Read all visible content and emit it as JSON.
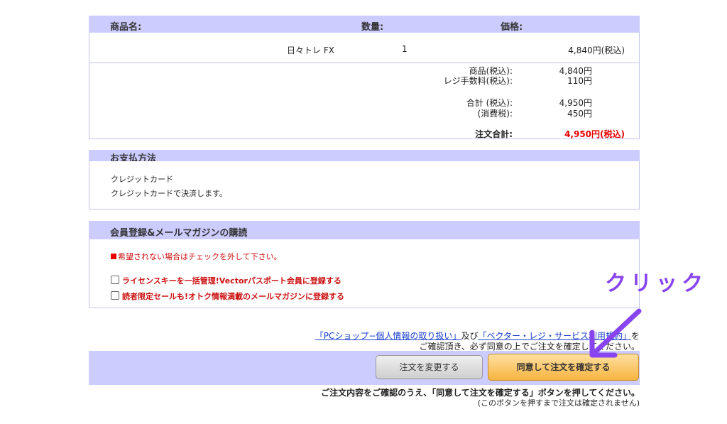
{
  "order_table": {
    "headers": {
      "product": "商品名:",
      "quantity": "数量:",
      "price": "価格:"
    },
    "row": {
      "product": "日々トレ  FX",
      "quantity": "1",
      "price": "4,840円(税込)"
    },
    "summary": {
      "product_label": "商品(税込):",
      "product_value": "4,840円",
      "fee_label": "レジ手数料(税込):",
      "fee_value": "110円",
      "total_label": "合計 (税込):",
      "total_value": "4,950円",
      "tax_label": "(消費税):",
      "tax_value": "450円",
      "order_total_label": "注文合計:",
      "order_total_value": "4,950円(税込)"
    }
  },
  "payment": {
    "title": "お支払方法",
    "method": "クレジットカード",
    "description": "クレジットカードで決済します。"
  },
  "membership": {
    "title": "会員登録&メールマガジンの購読",
    "notice": "希望されない場合はチェックを外して下さい。",
    "option1": "ライセンスキーを一括管理!Vectorパスポート会員に登録する",
    "option2": "読者限定セールも!オトク情報満載のメールマガジンに登録する"
  },
  "terms": {
    "link1": "「PCショップ−個人情報の取り扱い」",
    "and": "及び",
    "link2": "「ベクター・レジ・サービス利用規約」",
    "suffix": "を",
    "line2": "ご確認頂き、必ず同意の上でご注文を確定してください。"
  },
  "buttons": {
    "change": "注文を変更する",
    "confirm": "同意して注文を確定する"
  },
  "footer": {
    "line1": "ご注文内容をご確認のうえ、「同意して注文を確定する」ボタンを押してください。",
    "line2": "(このボタンを押すまで注文は確定されません)"
  },
  "annotation": {
    "label": "クリック",
    "color": "#8844ee"
  }
}
